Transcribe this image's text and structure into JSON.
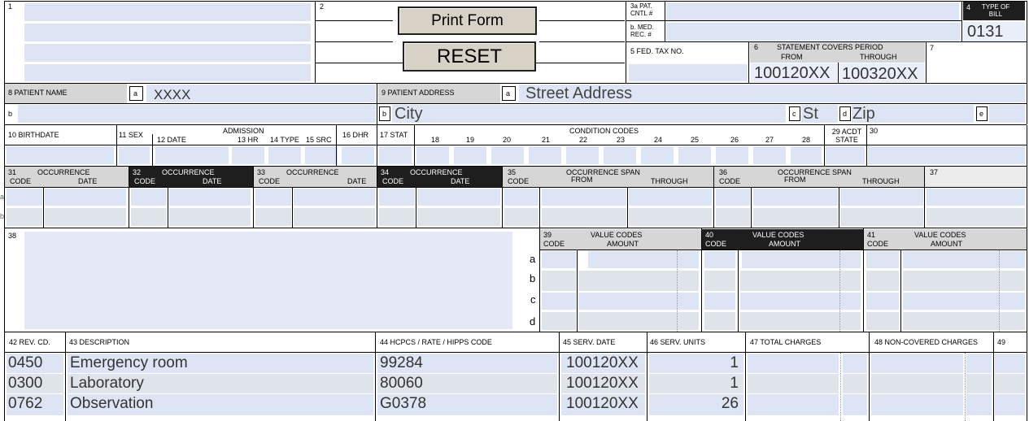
{
  "buttons": {
    "print": "Print Form",
    "reset": "RESET"
  },
  "header": {
    "f1": "1",
    "f2": "2",
    "f3a": "3a PAT. CNTL #",
    "f3b": "b. MED. REC. #",
    "f4": "4",
    "f4_label": "TYPE OF BILL",
    "type_of_bill": "0131",
    "f5": "5 FED. TAX NO.",
    "f6": "6",
    "f6_title": "STATEMENT COVERS PERIOD",
    "f6_from": "FROM",
    "f6_through": "THROUGH",
    "period_from": "100120XX",
    "period_through": "100320XX",
    "f7": "7"
  },
  "patient": {
    "f8": "8 PATIENT NAME",
    "a": "a",
    "name": "XXXX",
    "b": "b",
    "f9": "9 PATIENT ADDRESS",
    "street": "Street Address",
    "city": "City",
    "c": "c",
    "state": "St",
    "d": "d",
    "zip": "Zip",
    "e": "e"
  },
  "row10": {
    "birth": "10 BIRTHDATE",
    "sex": "11 SEX",
    "date": "12  DATE",
    "admission": "ADMISSION",
    "hr": "13 HR",
    "type": "14 TYPE",
    "src": "15 SRC",
    "dhr": "16 DHR",
    "stat": "17 STAT",
    "cond_title": "CONDITION CODES",
    "c18": "18",
    "c19": "19",
    "c20": "20",
    "c21": "21",
    "c22": "22",
    "c23": "23",
    "c24": "24",
    "c25": "25",
    "c26": "26",
    "c27": "27",
    "c28": "28",
    "acdt": "29 ACDT STATE",
    "c30": "30"
  },
  "occ": {
    "n31": "31",
    "n32": "32",
    "n33": "33",
    "n34": "34",
    "occ": "OCCURRENCE",
    "code": "CODE",
    "date": "DATE",
    "n35": "35",
    "n36": "36",
    "span": "OCCURRENCE SPAN",
    "from": "FROM",
    "through": "THROUGH",
    "n37": "37",
    "ra": "a",
    "rb": "b"
  },
  "values": {
    "n38": "38",
    "n39": "39",
    "n40": "40",
    "n41": "41",
    "title": "VALUE CODES",
    "code": "CODE",
    "amount": "AMOUNT",
    "a": "a",
    "b": "b",
    "c": "c",
    "d": "d"
  },
  "lines_header": {
    "rev": "42 REV. CD.",
    "desc": "43 DESCRIPTION",
    "hcpcs": "44 HCPCS / RATE / HIPPS CODE",
    "date": "45 SERV. DATE",
    "units": "46 SERV. UNITS",
    "total": "47 TOTAL CHARGES",
    "noncov": "48 NON-COVERED CHARGES",
    "n49": "49"
  },
  "lines": [
    {
      "rev": "0450",
      "desc": "Emergency room",
      "hcpcs": "99284",
      "date": "100120XX",
      "units": "1"
    },
    {
      "rev": "0300",
      "desc": "Laboratory",
      "hcpcs": "80060",
      "date": "100120XX",
      "units": "1"
    },
    {
      "rev": "0762",
      "desc": "Observation",
      "hcpcs": "G0378",
      "date": "100120XX",
      "units": "26"
    }
  ]
}
